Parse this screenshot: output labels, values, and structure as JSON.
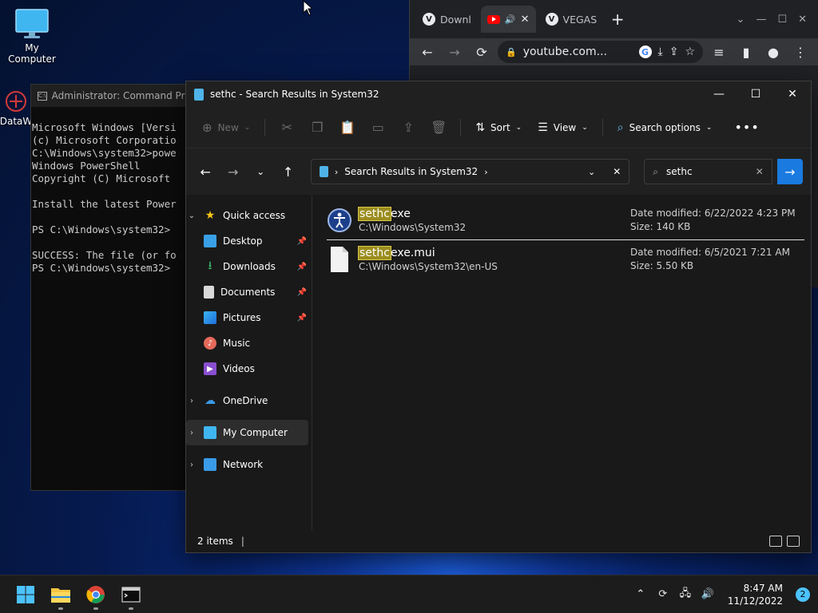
{
  "desktop": {
    "icons": [
      {
        "label": "My Computer"
      },
      {
        "label": "DataW"
      }
    ]
  },
  "cmd": {
    "title": "Administrator: Command Prompt",
    "lines": [
      "Microsoft Windows [Versi",
      "(c) Microsoft Corporatio",
      "C:\\Windows\\system32>powe",
      "Windows PowerShell",
      "Copyright (C) Microsoft ",
      "",
      "Install the latest Power",
      "",
      "PS C:\\Windows\\system32> ",
      "",
      "SUCCESS: The file (or fo",
      "PS C:\\Windows\\system32>"
    ]
  },
  "chrome": {
    "tabs": [
      {
        "label": "Downl"
      },
      {
        "label": ""
      },
      {
        "label": "VEGAS"
      }
    ],
    "url": "youtube.com..."
  },
  "explorer": {
    "title": "sethc - Search Results in System32",
    "toolbar": {
      "new": "New",
      "sort": "Sort",
      "view": "View",
      "search_options": "Search options"
    },
    "address": "Search Results in System32",
    "search_value": "sethc",
    "nav": {
      "quick_access": "Quick access",
      "desktop": "Desktop",
      "downloads": "Downloads",
      "documents": "Documents",
      "pictures": "Pictures",
      "music": "Music",
      "videos": "Videos",
      "onedrive": "OneDrive",
      "my_computer": "My Computer",
      "network": "Network"
    },
    "files": [
      {
        "name_hl": "sethc",
        "name_rest": "exe",
        "path": "C:\\Windows\\System32",
        "modified": "Date modified: 6/22/2022 4:23 PM",
        "size": "Size: 140 KB"
      },
      {
        "name_hl": "sethc",
        "name_rest": "exe.mui",
        "path": "C:\\Windows\\System32\\en-US",
        "modified": "Date modified: 6/5/2021 7:21 AM",
        "size": "Size: 5.50 KB"
      }
    ],
    "status": "2 items"
  },
  "taskbar": {
    "time": "8:47 AM",
    "date": "11/12/2022",
    "notifications": "2"
  },
  "colors": {
    "accent": "#1a7ae0",
    "highlight": "#9b8d1e"
  }
}
